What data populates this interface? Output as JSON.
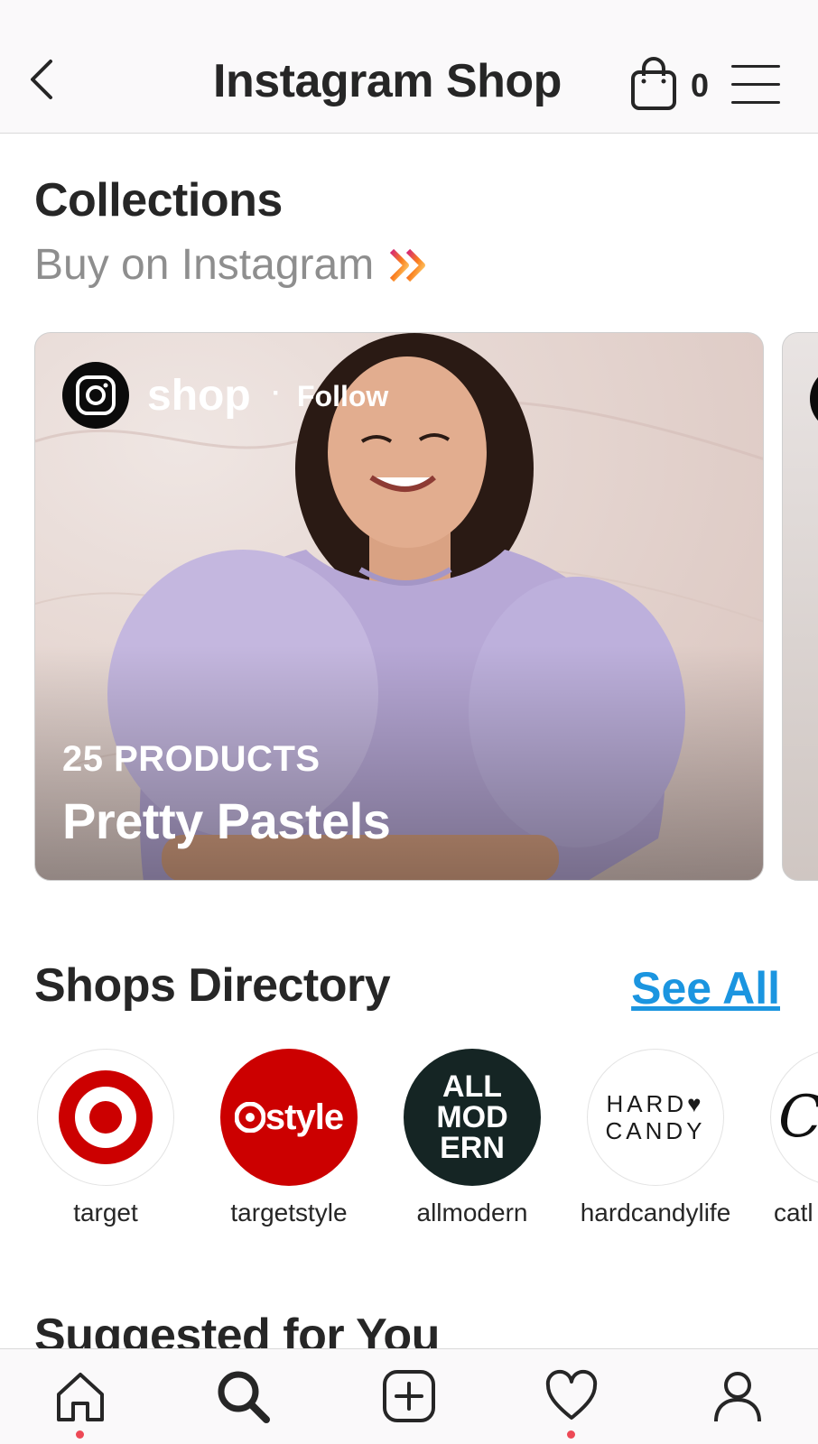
{
  "header": {
    "title": "Instagram Shop",
    "bag_count": "0",
    "back_icon": "chevron-left-icon",
    "bag_icon": "shopping-bag-icon",
    "menu_icon": "hamburger-menu-icon"
  },
  "collections": {
    "title": "Collections",
    "link_label": "Buy on Instagram",
    "link_icon": "double-chevron-right-icon",
    "cards": [
      {
        "shop_name": "shop",
        "separator": "·",
        "follow_label": "Follow",
        "product_count": "25 PRODUCTS",
        "name": "Pretty Pastels"
      }
    ]
  },
  "shops_directory": {
    "title": "Shops Directory",
    "see_all_label": "See All",
    "shops": [
      {
        "label": "target",
        "logo": "target-logo"
      },
      {
        "label": "targetstyle",
        "logo_text": "style"
      },
      {
        "label": "allmodern",
        "logo_text": [
          "ALL",
          "MOD",
          "ERN"
        ]
      },
      {
        "label": "hardcandylife",
        "logo_text": [
          "HARD♥",
          "CANDY"
        ]
      },
      {
        "label": "catl",
        "logo_text": "Ca"
      }
    ]
  },
  "suggested": {
    "title": "Suggested for You"
  },
  "bottom_nav": {
    "items": [
      "home-icon",
      "search-icon",
      "add-post-icon",
      "activity-heart-icon",
      "profile-icon"
    ],
    "accent_color": "#ed4956"
  },
  "colors": {
    "link_blue": "#1b95e0",
    "target_red": "#cc0000",
    "allmodern_dark": "#152524"
  }
}
